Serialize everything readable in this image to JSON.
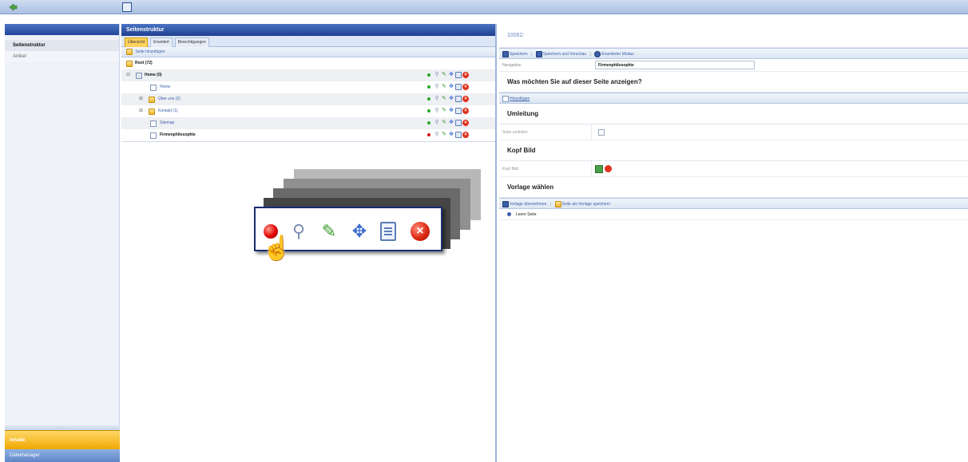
{
  "left": {
    "nav": [
      {
        "label": "Seitenstruktur"
      },
      {
        "label": "Artikel"
      }
    ],
    "bottom_buttons": {
      "inhalte": "Inhalte",
      "dateimanager": "Dateimanager"
    }
  },
  "middle": {
    "title": "Seitenstruktur",
    "tabs": [
      "Übersicht",
      "Erweitert",
      "Berechtigungen"
    ],
    "toolbar_add": "Seite hinzufügen",
    "tree": {
      "root": "Root (72)",
      "home_folder": "Home (0)",
      "home_page": "Home",
      "ueber_uns": "Über uns (2)",
      "kontakt": "Kontakt (1)",
      "sitemap": "Sitemap",
      "firmenphilosophie": "Firmenphilosophie"
    }
  },
  "right": {
    "page_id": "10062:",
    "toolbar": {
      "save": "Speichern",
      "save_preview": "Speichern und Vorschau",
      "advanced": "Erweiterter Modus"
    },
    "navigation_label": "Navigation",
    "navigation_value": "Firmenphilosophie",
    "question": "Was möchten Sie auf dieser Seite anzeigen?",
    "add_button": "Hinzufügen",
    "sections": {
      "umleitung": "Umleitung",
      "umleiten_label": "Seite umleiten",
      "kopf_bild": "Kopf Bild",
      "kopf_bild_label": "Kopf Bild",
      "vorlage": "Vorlage wählen"
    },
    "template_toolbar": {
      "apply": "Vorlage übernehmen",
      "save_as": "Seite als Vorlage speichern"
    },
    "templates": [
      "Leere Seite"
    ]
  },
  "colors": {
    "header_blue": "#23479a",
    "accent_orange": "#f0a800",
    "link_blue": "#3b5fa8"
  }
}
